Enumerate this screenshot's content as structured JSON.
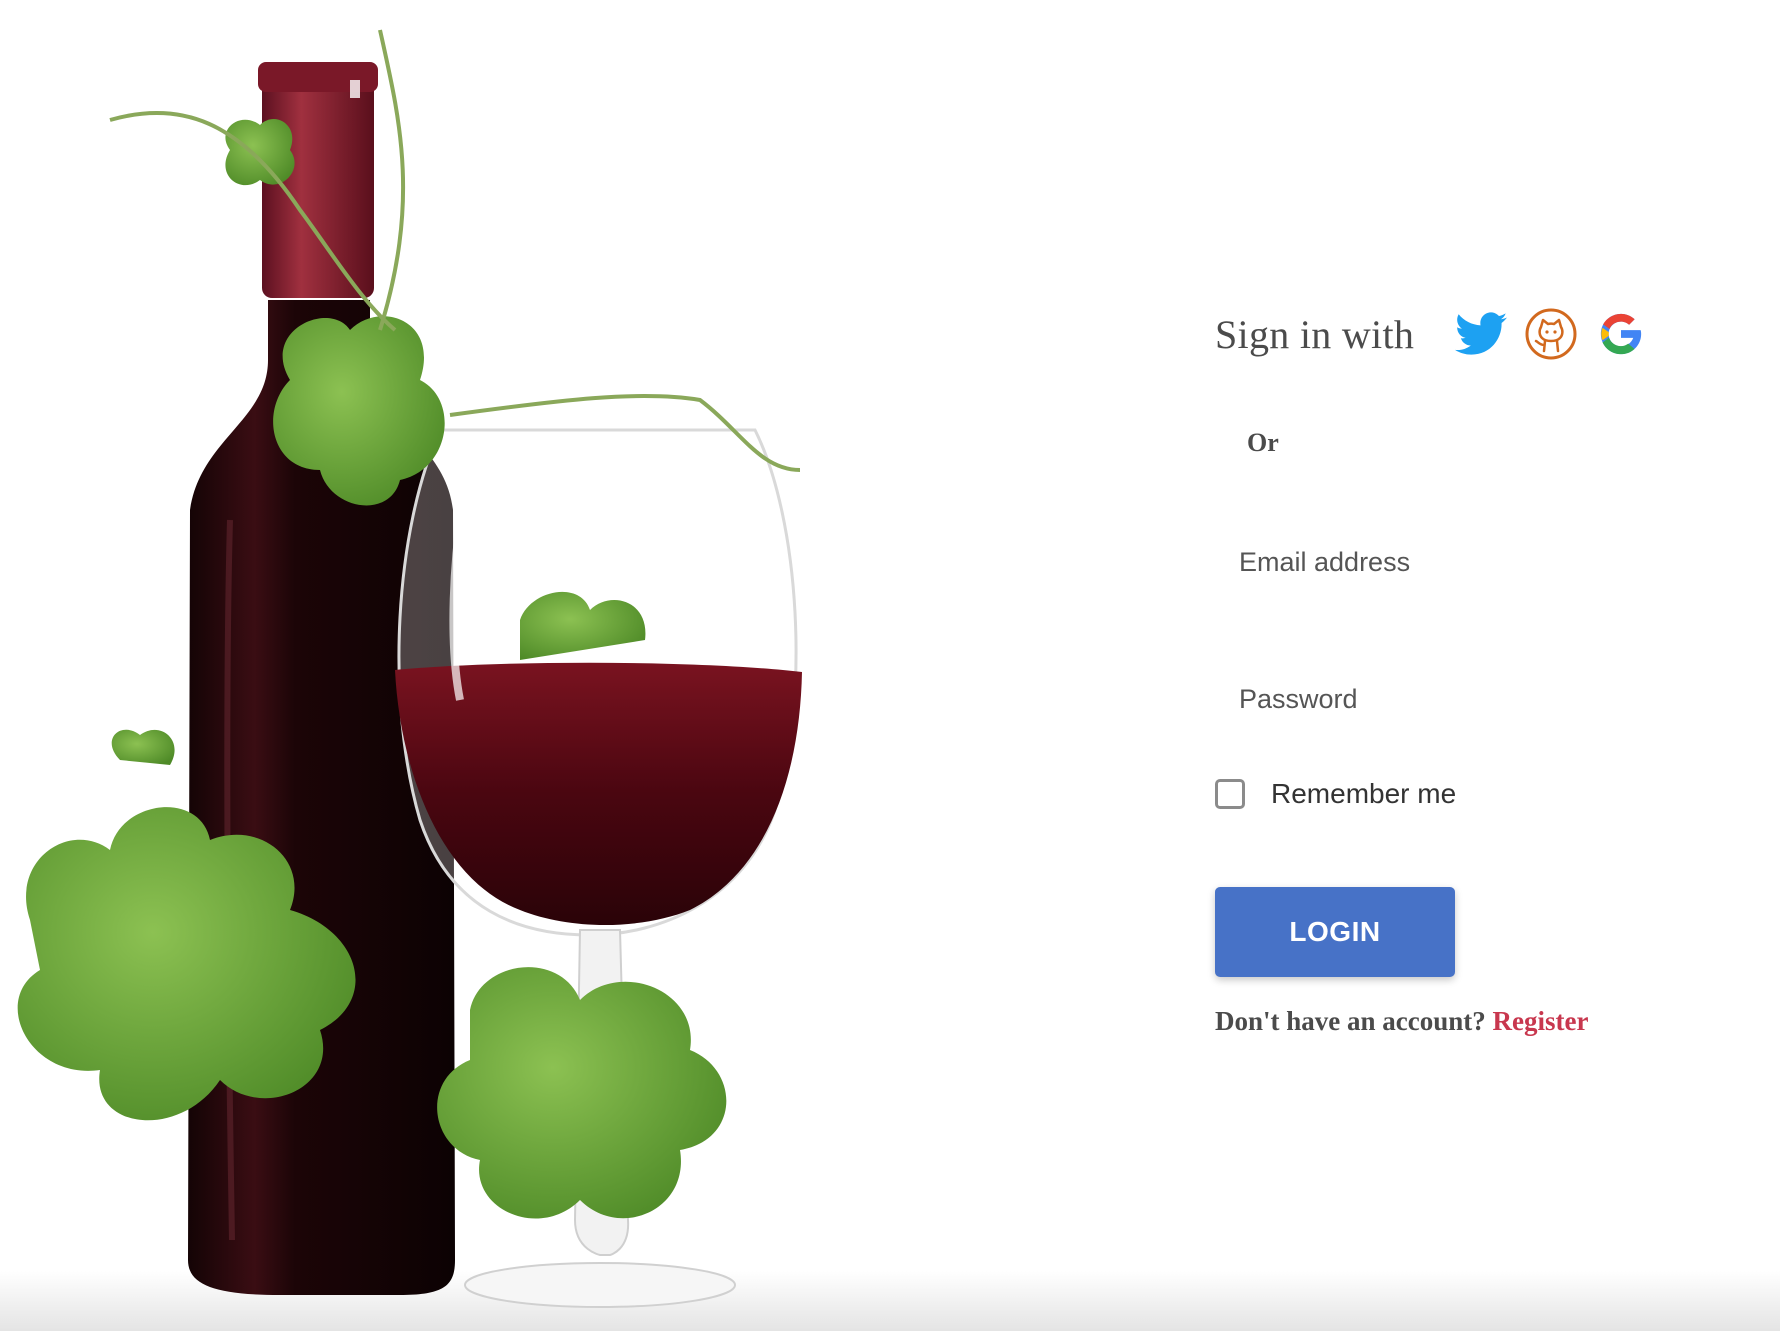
{
  "hero": {
    "image": "wine-bottle-and-glass-with-grape-leaves",
    "bottle_color": "#2a0b0f",
    "capsule_color": "#8a1d2e",
    "wine_color": "#5a0a14",
    "leaf_color": "#6aa23a"
  },
  "signin": {
    "label": "Sign in with",
    "providers": [
      {
        "name": "Twitter",
        "icon": "twitter-icon",
        "color": "#1da1f2"
      },
      {
        "name": "GitHub",
        "icon": "github-icon",
        "color": "#d2691e"
      },
      {
        "name": "Google",
        "icon": "google-icon",
        "color": "#4285f4"
      }
    ]
  },
  "divider": {
    "or_label": "Or"
  },
  "form": {
    "email_placeholder": "Email address",
    "password_placeholder": "Password",
    "remember_label": "Remember me",
    "remember_checked": false,
    "login_label": "LOGIN"
  },
  "footer": {
    "prompt": "Don't have an account?",
    "register_label": "Register"
  },
  "colors": {
    "accent": "#4772c7",
    "link": "#c8374e",
    "text": "#4b4b4b"
  }
}
